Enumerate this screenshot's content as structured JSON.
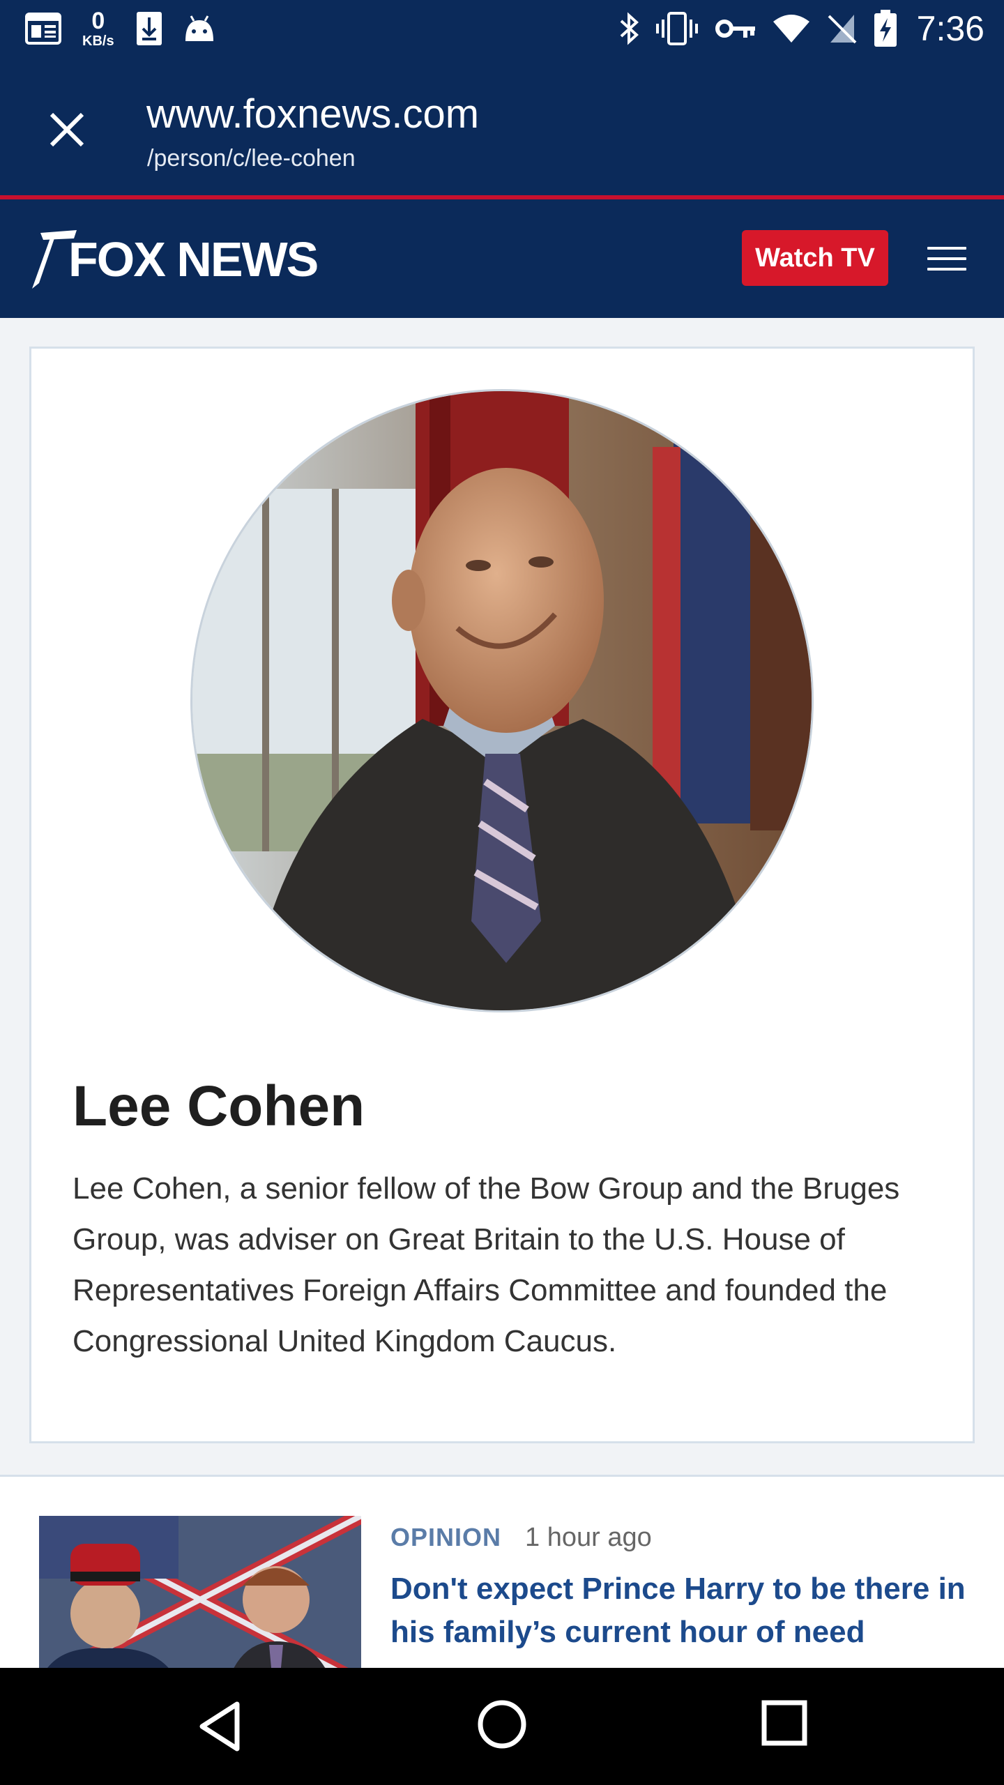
{
  "status_bar": {
    "time": "7:36",
    "net_speed_value": "0",
    "net_speed_unit": "KB/s",
    "icons_left": [
      "news-icon",
      "net-speed",
      "download-icon",
      "android-icon"
    ],
    "icons_right": [
      "bluetooth-icon",
      "vibrate-icon",
      "vpn-key-icon",
      "wifi-icon",
      "no-sim-icon",
      "battery-charging-icon"
    ]
  },
  "browser": {
    "url_host": "www.foxnews.com",
    "url_path": "/person/c/lee-cohen"
  },
  "site_header": {
    "logo_text": "FOX NEWS",
    "watch_tv_label": "Watch TV"
  },
  "bio": {
    "name": "Lee Cohen",
    "description": "Lee Cohen, a senior fellow of the Bow Group and the Bruges Group, was adviser on Great Britain to the U.S. House of Representatives Foreign Affairs Committee and founded the Congressional United Kingdom Caucus."
  },
  "articles": [
    {
      "category": "OPINION",
      "time": "1 hour ago",
      "headline": "Don't expect Prince Harry to be there in his family’s current hour of need"
    }
  ],
  "colors": {
    "navy": "#0b2a5a",
    "brand_red": "#d7182a",
    "headline_blue": "#1c4a8c",
    "category_blue": "#5a7ca8"
  }
}
